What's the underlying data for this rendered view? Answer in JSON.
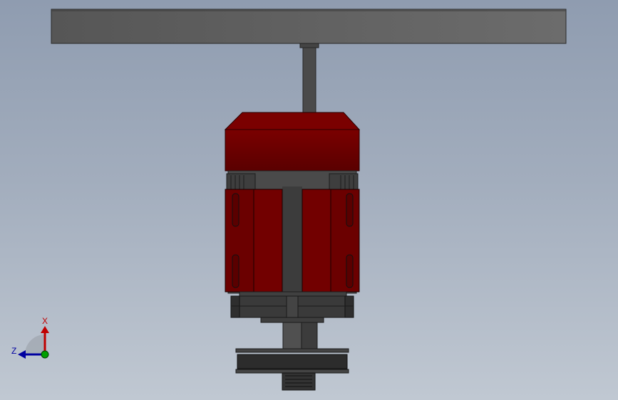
{
  "triad": {
    "x_label": "X",
    "z_label": "Z",
    "x_color": "#c00000",
    "z_color": "#0000a0",
    "y_color": "#00a000"
  },
  "colors": {
    "background_top": "#8f9cb0",
    "background_bottom": "#c0c8d2",
    "motor_body": "#6b0000",
    "motor_dark": "#3a0000",
    "frame_gray": "#5a5a5a",
    "shaft_gray": "#4a4a4a"
  }
}
